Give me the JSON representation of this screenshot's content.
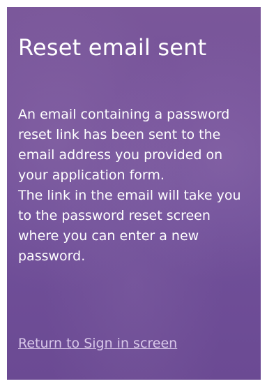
{
  "panel": {
    "title": "Reset email sent",
    "message_lines": [
      "An email containing a password reset link has been sent to the email address you provided on your application form.",
      "The link in the email will take you to the password reset screen where you can enter a new password."
    ],
    "return_link_label": "Return to Sign in screen"
  },
  "colors": {
    "panel_background": "#7a579a",
    "text": "#ffffff",
    "link": "#d9c8ea"
  }
}
